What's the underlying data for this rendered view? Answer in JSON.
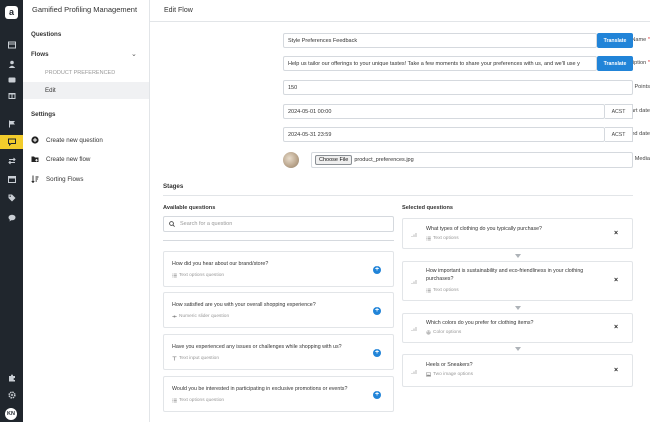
{
  "rail": {
    "logo": "a",
    "avatar": "KN",
    "icons": [
      "library-icon",
      "user-icon",
      "wallet-icon",
      "gift-icon",
      "flag-icon",
      "chat-icon",
      "exchange-icon",
      "calendar-icon",
      "tag-icon",
      "speech-icon",
      "puzzle-icon",
      "settings-icon"
    ],
    "accent": "#f2cc2c"
  },
  "sidenav": {
    "app_title": "Gamified Profiling Management",
    "questions": "Questions",
    "flows": "Flows",
    "product_preferenced": "PRODUCT PREFERENCED",
    "edit": "Edit",
    "settings": "Settings",
    "actions": [
      {
        "label": "Create new question",
        "icon": "plus-circle-icon"
      },
      {
        "label": "Create new flow",
        "icon": "folder-plus-icon"
      },
      {
        "label": "Sorting Flows",
        "icon": "sort-icon"
      }
    ]
  },
  "page": {
    "title": "Edit Flow"
  },
  "form": {
    "name_label": "Name",
    "name_value": "Style Preferences Feedback",
    "description_label": "Description",
    "description_value": "Help us tailor our offerings to your unique tastes! Take a few moments to share your preferences with us, and we'll use y",
    "translate": "Translate",
    "points_label": "Points",
    "points_value": "150",
    "start_label": "Start date",
    "start_value": "2024-05-01 00:00",
    "end_label": "End date",
    "end_value": "2024-05-31 23:59",
    "tz": "ACST",
    "media_label": "Media",
    "choose_file": "Choose File",
    "file_name": "product_preferences.jpg",
    "required_mark": "*"
  },
  "stages": {
    "title": "Stages",
    "available_title": "Available questions",
    "selected_title": "Selected questions",
    "search_placeholder": "Search for a question",
    "available": [
      {
        "title": "How did you hear about our brand/store?",
        "type": "Text options question",
        "icon": "list-icon"
      },
      {
        "title": "How satisfied are you with your overall shopping experience?",
        "type": "Numeric slider question",
        "icon": "slider-icon"
      },
      {
        "title": "Have you experienced any issues or challenges while shopping with us?",
        "type": "Text input question",
        "icon": "text-icon"
      },
      {
        "title": "Would you be interested in participating in exclusive promotions or events?",
        "type": "Text options question",
        "icon": "list-icon"
      }
    ],
    "selected": [
      {
        "title": "What types of clothing do you typically purchase?",
        "type": "Text options",
        "icon": "list-icon"
      },
      {
        "title": "How important is sustainability and eco-friendliness in your clothing purchases?",
        "type": "Text options",
        "icon": "list-icon"
      },
      {
        "title": "Which colors do you prefer for clothing items?",
        "type": "Color options",
        "icon": "palette-icon"
      },
      {
        "title": "Heels or Sneakers?",
        "type": "Two image options",
        "icon": "image-icon"
      }
    ],
    "remove": "×",
    "add": "+"
  }
}
